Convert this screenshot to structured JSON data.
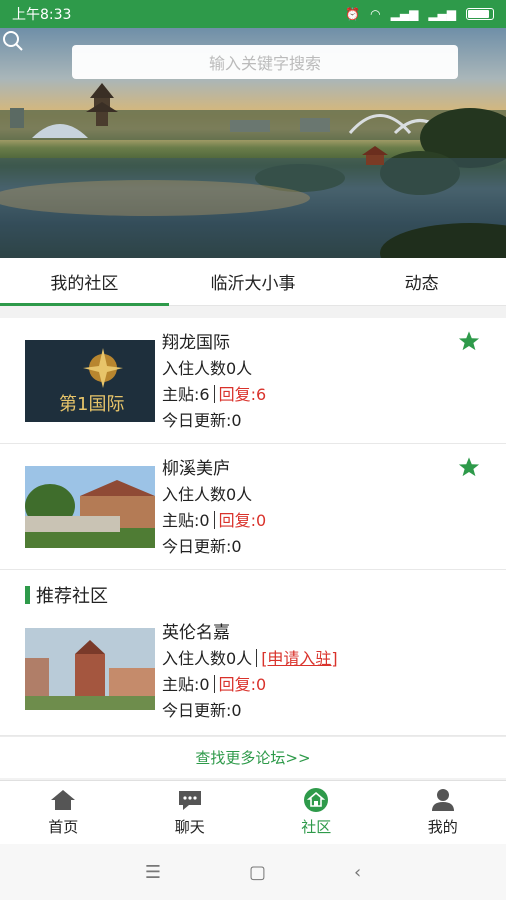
{
  "status": {
    "time": "上午8:33"
  },
  "search": {
    "placeholder": "输入关键字搜索"
  },
  "tabs": [
    {
      "label": "我的社区"
    },
    {
      "label": "临沂大小事"
    },
    {
      "label": "动态"
    }
  ],
  "my_communities": [
    {
      "name": "翔龙国际",
      "residents": "入住人数0人",
      "posts": "主贴:6",
      "replies": "回复:6",
      "today": "今日更新:0"
    },
    {
      "name": "柳溪美庐",
      "residents": "入住人数0人",
      "posts": "主贴:0",
      "replies": "回复:0",
      "today": "今日更新:0"
    }
  ],
  "recommended": {
    "title": "推荐社区",
    "items": [
      {
        "name": "英伦名嘉",
        "residents": "入住人数0人",
        "apply": "[申请入驻]",
        "posts": "主贴:0",
        "replies": "回复:0",
        "today": "今日更新:0"
      }
    ]
  },
  "more_link": "查找更多论坛>>",
  "bottom_nav": [
    {
      "label": "首页"
    },
    {
      "label": "聊天"
    },
    {
      "label": "社区"
    },
    {
      "label": "我的"
    }
  ],
  "colors": {
    "accent": "#2e9a4a",
    "red": "#d9322b"
  }
}
